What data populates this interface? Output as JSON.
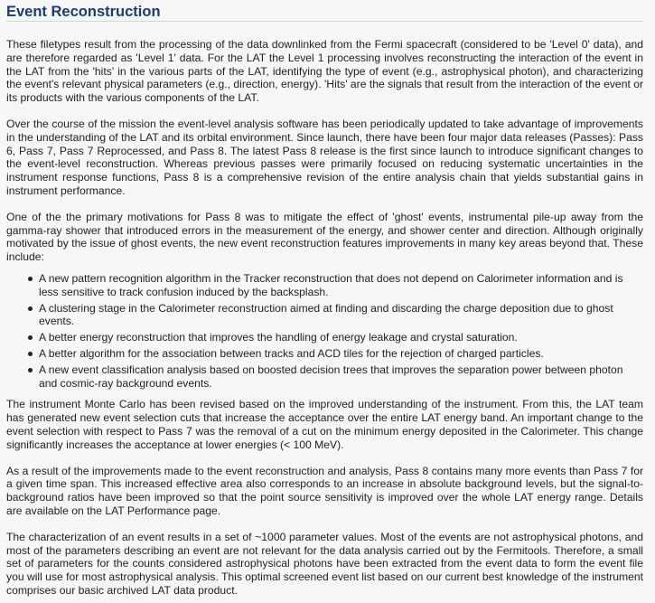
{
  "heading": "Event Reconstruction",
  "paragraphs": {
    "p1": "These filetypes result from the processing of the data downlinked from the Fermi spacecraft (considered to be 'Level 0' data), and are therefore regarded as 'Level 1' data. For the LAT the Level 1 processing involves reconstructing the interaction of the event in the LAT from the 'hits' in the various parts of the LAT, identifying the type of event (e.g., astrophysical photon), and characterizing the event's relevant physical parameters (e.g., direction, energy). 'Hits' are the signals that result from the interaction of the event or its products with the various components of the LAT.",
    "p2": "Over the course of the mission the event-level analysis software has been periodically updated to take advantage of improvements in the understanding of the LAT and its orbital environment. Since launch, there have been four major data releases (Passes): Pass 6, Pass 7, Pass 7 Reprocessed, and Pass 8. The latest Pass 8 release is the first since launch to introduce significant changes to the event-level reconstruction. Whereas previous passes were primarily focused on reducing systematic uncertainties in the instrument response functions, Pass 8 is a comprehensive revision of the entire analysis chain that yields substantial gains in instrument performance.",
    "p3": "One of the the primary motivations for Pass 8 was to mitigate the effect of 'ghost' events, instrumental pile-up away from the gamma-ray shower that introduced errors in the measurement of the energy, and shower center and direction. Although originally motivated by the issue of ghost events, the new event reconstruction features improvements in many key areas beyond that. These include:",
    "p4": "The instrument Monte Carlo has been revised based on the improved understanding of the instrument. From this, the LAT team has generated new event selection cuts that increase the acceptance over the entire LAT energy band. An important change to the event selection with respect to Pass 7 was the removal of a cut on the minimum energy deposited in the Calorimeter. This change significantly increases the acceptance at lower energies (< 100 MeV).",
    "p5": "As a result of the improvements made to the event reconstruction and analysis, Pass 8 contains many more events than Pass 7 for a given time span. This increased effective area also corresponds to an increase in absolute background levels, but the signal-to-background ratios have been improved so that the point source sensitivity is improved over the whole LAT energy range. Details are available on the LAT Performance page.",
    "p6": "The characterization of an event results in a set of ~1000 parameter values. Most of the events are not astrophysical photons, and most of the parameters describing an event are not relevant for the data analysis carried out by the Fermitools. Therefore, a small set of parameters for the counts considered astrophysical photons have been extracted from the event data to form the event file you will use for most astrophysical analysis. This optimal screened event list based on our current best knowledge of the instrument comprises our basic archived LAT data product."
  },
  "improvements": [
    "A new pattern recognition algorithm in the Tracker reconstruction that does not depend on Calorimeter information and is less sensitive to track confusion induced by the backsplash.",
    "A clustering stage in the Calorimeter reconstruction aimed at finding and discarding the charge deposition due to ghost events.",
    "A better energy reconstruction that improves the handling of energy leakage and crystal saturation.",
    "A better algorithm for the association between tracks and ACD tiles for the rejection of charged particles.",
    "A new event classification analysis based on boosted decision trees that improves the separation power between photon and cosmic-ray background events."
  ],
  "colors": {
    "heading": "#1b3a78",
    "text": "#222222",
    "background": "#f7f7f7"
  }
}
